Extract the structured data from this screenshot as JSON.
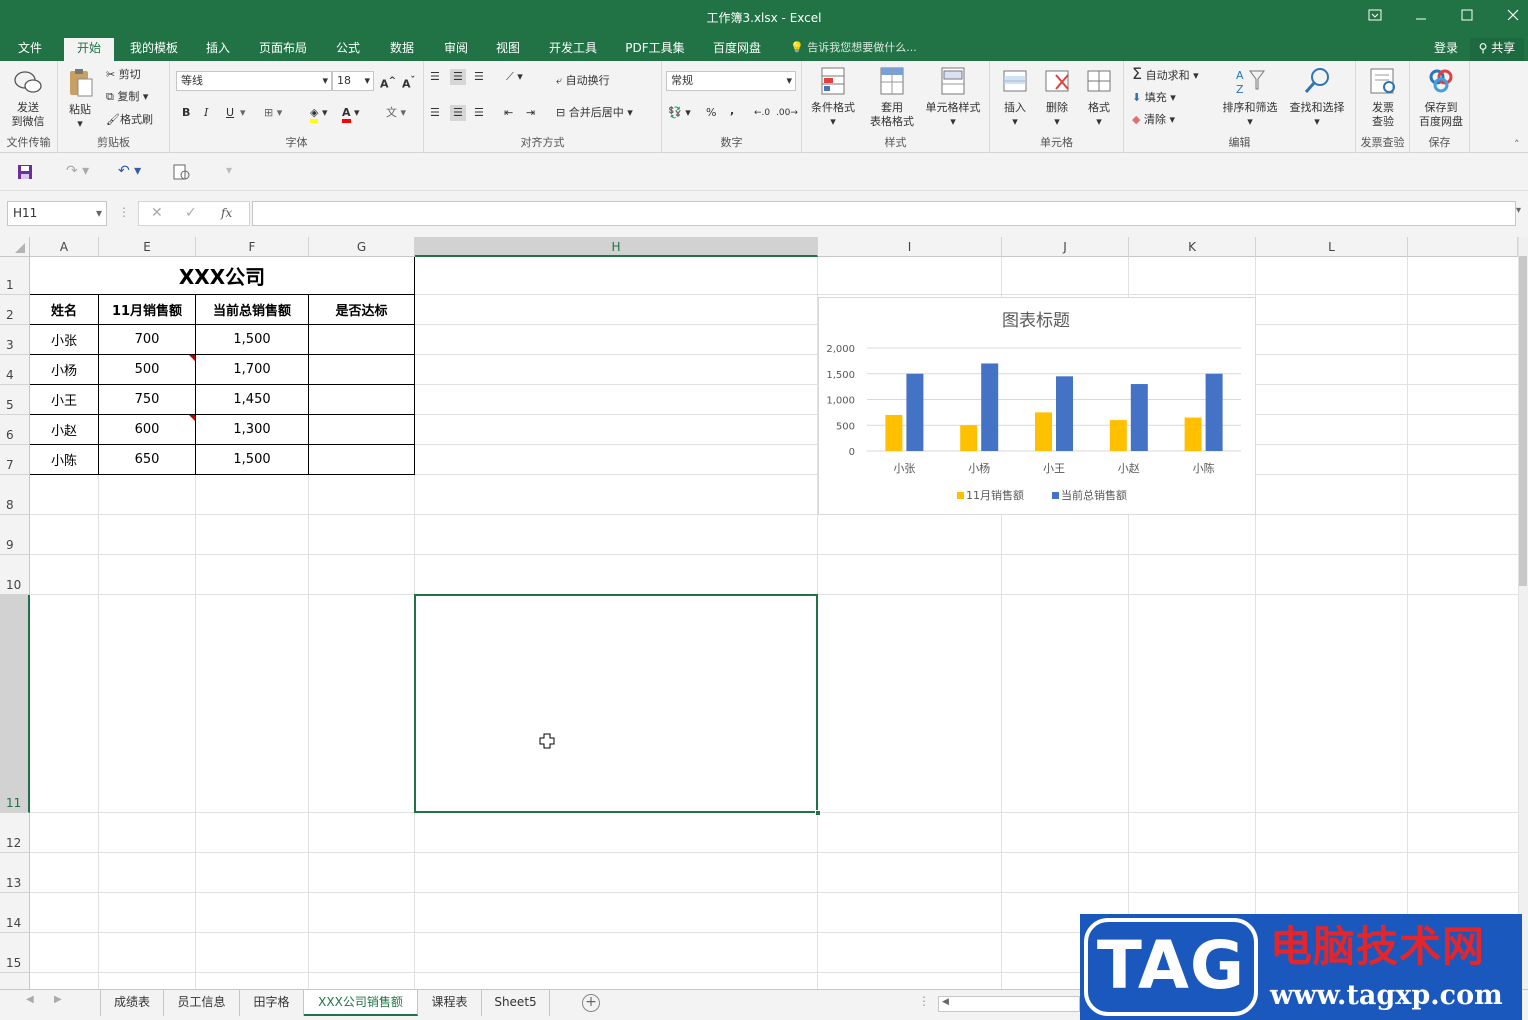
{
  "window": {
    "title": "工作簿3.xlsx  -  Excel"
  },
  "ribbon_tabs": [
    "文件",
    "开始",
    "我的模板",
    "插入",
    "页面布局",
    "公式",
    "数据",
    "审阅",
    "视图",
    "开发工具",
    "PDF工具集",
    "百度网盘"
  ],
  "active_tab": "开始",
  "tell_me": "告诉我您想要做什么...",
  "account": {
    "login": "登录",
    "share": "共享"
  },
  "ribbon": {
    "groups": {
      "file_transfer": "文件传输",
      "clipboard": "剪贴板",
      "font": "字体",
      "alignment": "对齐方式",
      "number": "数字",
      "styles": "样式",
      "cells": "单元格",
      "editing": "编辑",
      "invoice": "发票查验",
      "save": "保存"
    },
    "send_wechat_1": "发送",
    "send_wechat_2": "到微信",
    "paste": "粘贴",
    "cut": "剪切",
    "copy": "复制",
    "format_painter": "格式刷",
    "font_name": "等线",
    "font_size": "18",
    "bold": "B",
    "italic": "I",
    "underline": "U",
    "wrap_text": "自动换行",
    "merge_center": "合并后居中",
    "number_format": "常规",
    "percent": "%",
    "comma": ",",
    "cond_format": "条件格式",
    "table_format_1": "套用",
    "table_format_2": "表格格式",
    "cell_styles": "单元格样式",
    "insert": "插入",
    "delete": "删除",
    "format": "格式",
    "autosum": "自动求和",
    "fill": "填充",
    "clear": "清除",
    "sort_filter": "排序和筛选",
    "find_select": "查找和选择",
    "invoice_1": "发票",
    "invoice_2": "查验",
    "save_baidu_1": "保存到",
    "save_baidu_2": "百度网盘"
  },
  "name_box": "H11",
  "columns": [
    "A",
    "E",
    "F",
    "G",
    "H",
    "I",
    "J",
    "K",
    "L"
  ],
  "rows": [
    "1",
    "2",
    "3",
    "4",
    "5",
    "6",
    "7",
    "8",
    "9",
    "10",
    "11",
    "12",
    "13",
    "14",
    "15"
  ],
  "table": {
    "title": "XXX公司",
    "headers": [
      "姓名",
      "11月销售额",
      "当前总销售额",
      "是否达标"
    ],
    "rows": [
      [
        "小张",
        "700",
        "1,500",
        ""
      ],
      [
        "小杨",
        "500",
        "1,700",
        ""
      ],
      [
        "小王",
        "750",
        "1,450",
        ""
      ],
      [
        "小赵",
        "600",
        "1,300",
        ""
      ],
      [
        "小陈",
        "650",
        "1,500",
        ""
      ]
    ]
  },
  "chart_data": {
    "type": "bar",
    "title": "图表标题",
    "categories": [
      "小张",
      "小杨",
      "小王",
      "小赵",
      "小陈"
    ],
    "series": [
      {
        "name": "11月销售额",
        "values": [
          700,
          500,
          750,
          600,
          650
        ],
        "color": "#ffc000"
      },
      {
        "name": "当前总销售额",
        "values": [
          1500,
          1700,
          1450,
          1300,
          1500
        ],
        "color": "#4472c4"
      }
    ],
    "ylim": [
      0,
      2000
    ],
    "yticks": [
      "0",
      "500",
      "1,000",
      "1,500",
      "2,000"
    ],
    "legend": "bottom",
    "grid": true
  },
  "sheets": [
    "成绩表",
    "员工信息",
    "田字格",
    "XXX公司销售额",
    "课程表",
    "Sheet5"
  ],
  "active_sheet": "XXX公司销售额",
  "watermark": {
    "brand": "TAG",
    "site_name": "电脑技术网",
    "url": "www.tagxp.com"
  },
  "colors": {
    "excel_green": "#217346",
    "watermark_blue": "#1a58bd",
    "watermark_red": "#e4262a"
  }
}
